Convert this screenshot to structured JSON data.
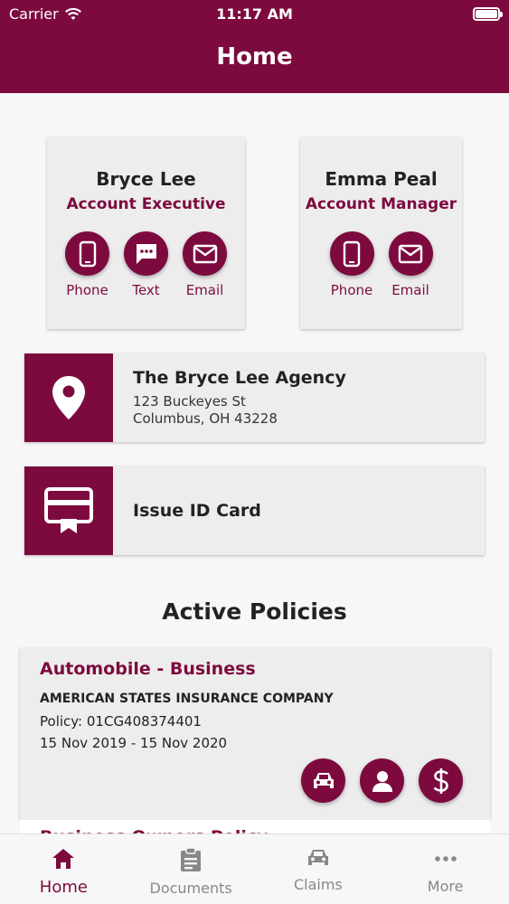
{
  "status_bar": {
    "carrier": "Carrier",
    "time": "11:17 AM"
  },
  "header": {
    "title": "Home"
  },
  "contacts": [
    {
      "name": "Bryce Lee",
      "role": "Account Executive",
      "actions": [
        "Phone",
        "Text",
        "Email"
      ]
    },
    {
      "name": "Emma Peal",
      "role": "Account Manager",
      "actions": [
        "Phone",
        "Email"
      ]
    }
  ],
  "agency": {
    "name": "The Bryce Lee Agency",
    "address_line1": "123 Buckeyes St",
    "address_line2": "Columbus, OH 43228"
  },
  "id_card": {
    "label": "Issue ID Card"
  },
  "policies_section": {
    "title": "Active Policies"
  },
  "policies": [
    {
      "type": "Automobile - Business",
      "company": "AMERICAN STATES INSURANCE COMPANY",
      "policy": "Policy: 01CG408374401",
      "dates": "15 Nov 2019 - 15 Nov 2020"
    }
  ],
  "next_policy_peek": "Business Owners Policy",
  "tabs": [
    {
      "label": "Home",
      "icon": "home-icon",
      "active": true
    },
    {
      "label": "Documents",
      "icon": "clipboard-icon",
      "active": false
    },
    {
      "label": "Claims",
      "icon": "car-icon",
      "active": false
    },
    {
      "label": "More",
      "icon": "more-dots-icon",
      "active": false
    }
  ],
  "colors": {
    "brand": "#7d0a3f",
    "background": "#f7f7f7",
    "card": "#ededed",
    "inactive_tab": "#888888"
  }
}
